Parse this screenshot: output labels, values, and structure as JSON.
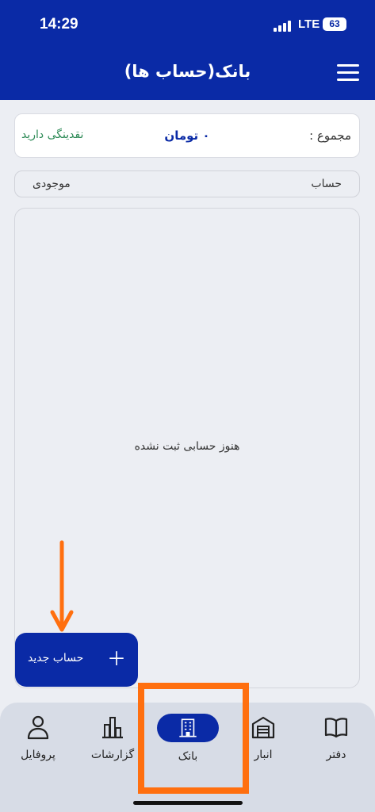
{
  "status_bar": {
    "time": "14:29",
    "network": "LTE",
    "battery": "63"
  },
  "header": {
    "title": "بانک(حساب ها)",
    "menu_icon": "hamburger-menu-icon"
  },
  "summary": {
    "label": "مجموع :",
    "amount": "۰ تومان",
    "status": "نقدینگی دارید"
  },
  "table_header": {
    "account": "حساب",
    "balance": "موجودی"
  },
  "empty_message": "هنوز حسابی ثبت نشده",
  "fab": {
    "label": "حساب جدید",
    "icon": "plus-icon"
  },
  "bottom_nav": {
    "items": [
      {
        "label": "دفتر",
        "icon": "book-icon"
      },
      {
        "label": "انبار",
        "icon": "warehouse-icon"
      },
      {
        "label": "بانک",
        "icon": "bank-icon",
        "active": true
      },
      {
        "label": "گزارشات",
        "icon": "bar-chart-icon"
      },
      {
        "label": "پروفایل",
        "icon": "user-icon"
      }
    ]
  },
  "colors": {
    "primary": "#0a2aa6",
    "annotation": "#ff6f0f",
    "positive": "#2e8b57",
    "background": "#eceef3"
  }
}
